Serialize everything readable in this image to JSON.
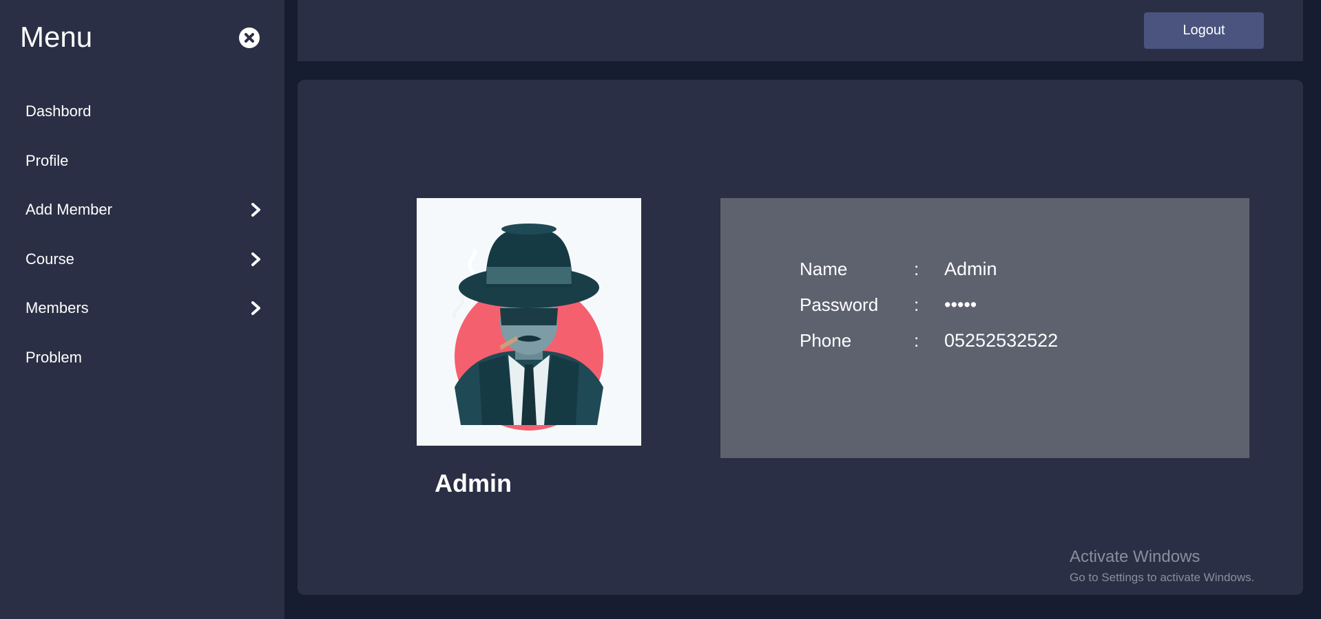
{
  "sidebar": {
    "title": "Menu",
    "items": [
      {
        "label": "Dashbord",
        "has_submenu": false
      },
      {
        "label": "Profile",
        "has_submenu": false
      },
      {
        "label": "Add Member",
        "has_submenu": true
      },
      {
        "label": "Course",
        "has_submenu": true
      },
      {
        "label": "Members",
        "has_submenu": true
      },
      {
        "label": "Problem",
        "has_submenu": false
      }
    ]
  },
  "header": {
    "logout_label": "Logout"
  },
  "profile": {
    "display_name": "Admin",
    "fields": [
      {
        "label": "Name",
        "separator": ":",
        "value": "Admin"
      },
      {
        "label": "Password",
        "separator": ":",
        "value": "•••••"
      },
      {
        "label": "Phone",
        "separator": ":",
        "value": "05252532522"
      }
    ]
  },
  "watermark": {
    "title": "Activate Windows",
    "subtitle": "Go to Settings to activate Windows."
  },
  "colors": {
    "page_bg": "#161d30",
    "panel_bg": "#2a2f45",
    "button_bg": "#4a547e",
    "info_bg": "#5e626f",
    "avatar_accent": "#f5606f"
  },
  "icons": {
    "close": "close-icon",
    "submenu": "chevron-right-icon",
    "avatar": "detective-avatar-icon"
  }
}
